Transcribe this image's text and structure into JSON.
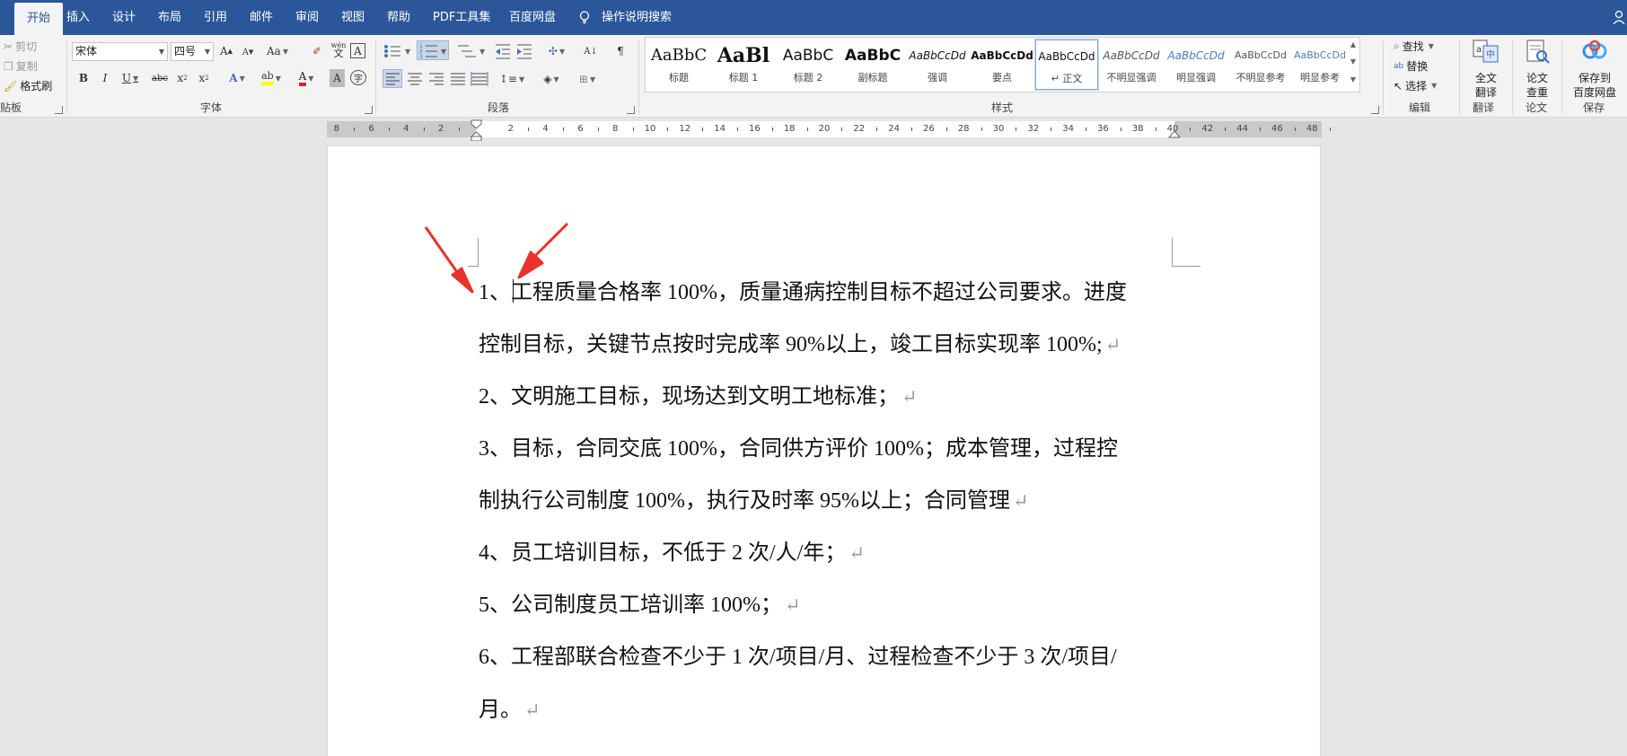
{
  "tabs": [
    "开始",
    "插入",
    "设计",
    "布局",
    "引用",
    "邮件",
    "审阅",
    "视图",
    "帮助",
    "PDF工具集",
    "百度网盘"
  ],
  "tell_me": "操作说明搜索",
  "clipboard": {
    "cut": "剪切",
    "copy": "复制",
    "format_painter": "格式刷",
    "label": "贴板"
  },
  "font": {
    "name": "宋体",
    "size": "四号",
    "label": "字体",
    "change_case": "Aa",
    "phonetic_top": "wén",
    "phonetic_bottom": "文"
  },
  "paragraph": {
    "label": "段落"
  },
  "styles": {
    "label": "样式",
    "items": [
      {
        "preview": "AaBbC",
        "name": "标题"
      },
      {
        "preview": "AaBl",
        "name": "标题 1"
      },
      {
        "preview": "AaBbC",
        "name": "标题 2"
      },
      {
        "preview": "AaBbC",
        "name": "副标题"
      },
      {
        "preview": "AaBbCcDd",
        "name": "强调"
      },
      {
        "preview": "AaBbCcDd",
        "name": "要点"
      },
      {
        "preview": "AaBbCcDd",
        "name": "↵ 正文"
      },
      {
        "preview": "AaBbCcDd",
        "name": "不明显强调"
      },
      {
        "preview": "AaBbCcDd",
        "name": "明显强调"
      },
      {
        "preview": "AaBbCcDd",
        "name": "不明显参考"
      },
      {
        "preview": "AaBbCcDd",
        "name": "明显参考"
      }
    ]
  },
  "editing": {
    "find": "查找",
    "replace": "替换",
    "select": "选择",
    "label": "编辑"
  },
  "translate": {
    "btn_line1": "全文",
    "btn_line2": "翻译",
    "label": "翻译"
  },
  "paper": {
    "btn_line1": "论文",
    "btn_line2": "查重",
    "label": "论文"
  },
  "save": {
    "btn_line1": "保存到",
    "btn_line2": "百度网盘",
    "label": "保存"
  },
  "ruler_numbers": [
    "8",
    "6",
    "4",
    "2",
    "2",
    "4",
    "6",
    "8",
    "10",
    "12",
    "14",
    "16",
    "18",
    "20",
    "22",
    "24",
    "26",
    "28",
    "30",
    "32",
    "34",
    "36",
    "38",
    "40",
    "42",
    "44",
    "46",
    "48"
  ],
  "document_lines": [
    "1、工程质量合格率 100%，质量通病控制目标不超过公司要求。进度",
    "控制目标，关键节点按时完成率 90%以上，竣工目标实现率 100%;",
    "2、文明施工目标，现场达到文明工地标准；",
    "3、目标，合同交底 100%，合同供方评价 100%；成本管理，过程控",
    "制执行公司制度 100%，执行及时率 95%以上；合同管理",
    "4、员工培训目标，不低于 2 次/人/年；",
    "5、公司制度员工培训率 100%；",
    "6、工程部联合检查不少于 1 次/项目/月、过程检查不少于 3 次/项目/",
    "月。"
  ],
  "paragraph_mark": "↵",
  "colors": {
    "ribbon_blue": "#2b579a",
    "arrow_red": "#e8322b"
  }
}
